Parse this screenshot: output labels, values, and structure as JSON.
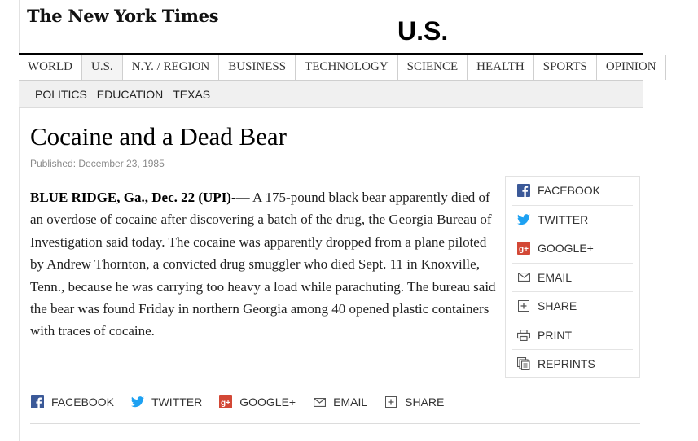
{
  "masthead": {
    "logo_text": "The New York Times",
    "section": "U.S."
  },
  "nav": {
    "primary": [
      "WORLD",
      "U.S.",
      "N.Y. / REGION",
      "BUSINESS",
      "TECHNOLOGY",
      "SCIENCE",
      "HEALTH",
      "SPORTS",
      "OPINION"
    ],
    "active": "U.S.",
    "secondary": [
      "POLITICS",
      "EDUCATION",
      "TEXAS"
    ]
  },
  "article": {
    "headline": "Cocaine and a Dead Bear",
    "published": "Published: December 23, 1985",
    "lede": "BLUE RIDGE, Ga., Dec. 22 (UPI)-—",
    "body": " A 175-pound black bear apparently died of an overdose of cocaine after discovering a batch of the drug, the Georgia Bureau of Investigation said today. The cocaine was apparently dropped from a plane piloted by Andrew Thornton, a convicted drug smuggler who died Sept. 11 in Knoxville, Tenn., because he was carrying too heavy a load while parachuting. The bureau said the bear was found Friday in northern Georgia among 40 opened plastic containers with traces of cocaine."
  },
  "share_box": [
    {
      "label": "FACEBOOK",
      "icon": "facebook-icon"
    },
    {
      "label": "TWITTER",
      "icon": "twitter-icon"
    },
    {
      "label": "GOOGLE+",
      "icon": "google-plus-icon"
    },
    {
      "label": "EMAIL",
      "icon": "email-icon"
    },
    {
      "label": "SHARE",
      "icon": "share-icon"
    },
    {
      "label": "PRINT",
      "icon": "print-icon"
    },
    {
      "label": "REPRINTS",
      "icon": "reprints-icon"
    }
  ],
  "bottom_share": [
    {
      "label": "FACEBOOK",
      "icon": "facebook-icon"
    },
    {
      "label": "TWITTER",
      "icon": "twitter-icon"
    },
    {
      "label": "GOOGLE+",
      "icon": "google-plus-icon"
    },
    {
      "label": "EMAIL",
      "icon": "email-icon"
    },
    {
      "label": "SHARE",
      "icon": "share-icon"
    }
  ],
  "colors": {
    "facebook": "#3b5998",
    "twitter": "#1da1f2",
    "google_plus": "#d34836",
    "icon_gray": "#555555"
  }
}
